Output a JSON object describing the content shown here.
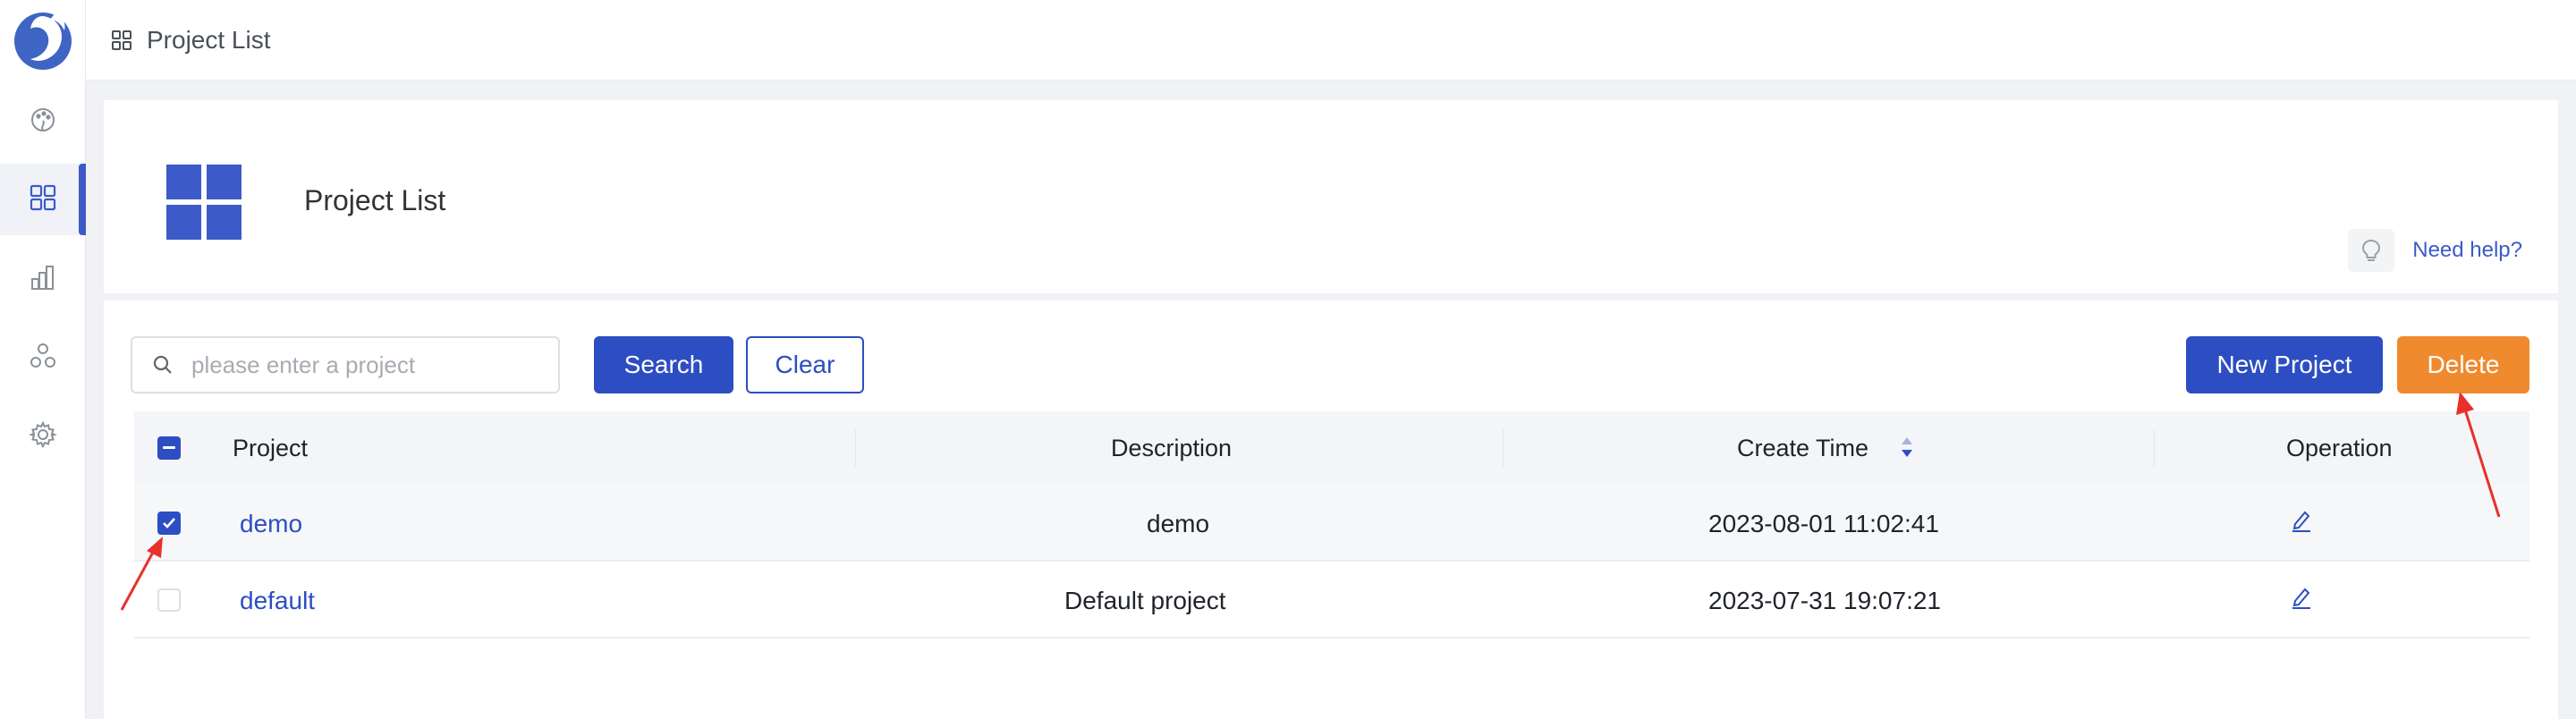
{
  "topbar": {
    "breadcrumb": "Project List"
  },
  "sidebar": {
    "items": [
      {
        "name": "dashboard",
        "icon": "palette-icon",
        "active": false
      },
      {
        "name": "projects",
        "icon": "grid-icon",
        "active": true
      },
      {
        "name": "statistics",
        "icon": "bar-chart-icon",
        "active": false
      },
      {
        "name": "resources",
        "icon": "cluster-icon",
        "active": false
      },
      {
        "name": "settings",
        "icon": "gear-icon",
        "active": false
      }
    ]
  },
  "page": {
    "title": "Project List",
    "help_label": "Need help?"
  },
  "toolbar": {
    "search_placeholder": "please enter a project",
    "search_value": "",
    "search_label": "Search",
    "clear_label": "Clear",
    "new_label": "New Project",
    "delete_label": "Delete"
  },
  "table": {
    "columns": [
      "Project",
      "Description",
      "Create Time",
      "Operation"
    ],
    "rows": [
      {
        "project": "demo",
        "description": "demo",
        "create_time": "2023-08-01 11:02:41",
        "checked": true
      },
      {
        "project": "default",
        "description": "Default project",
        "create_time": "2023-07-31 19:07:21",
        "checked": false
      }
    ],
    "header_checkbox": "indeterminate"
  },
  "colors": {
    "primary": "#2d4ec2",
    "danger": "#f08a2e",
    "annotation": "#e8302a"
  }
}
